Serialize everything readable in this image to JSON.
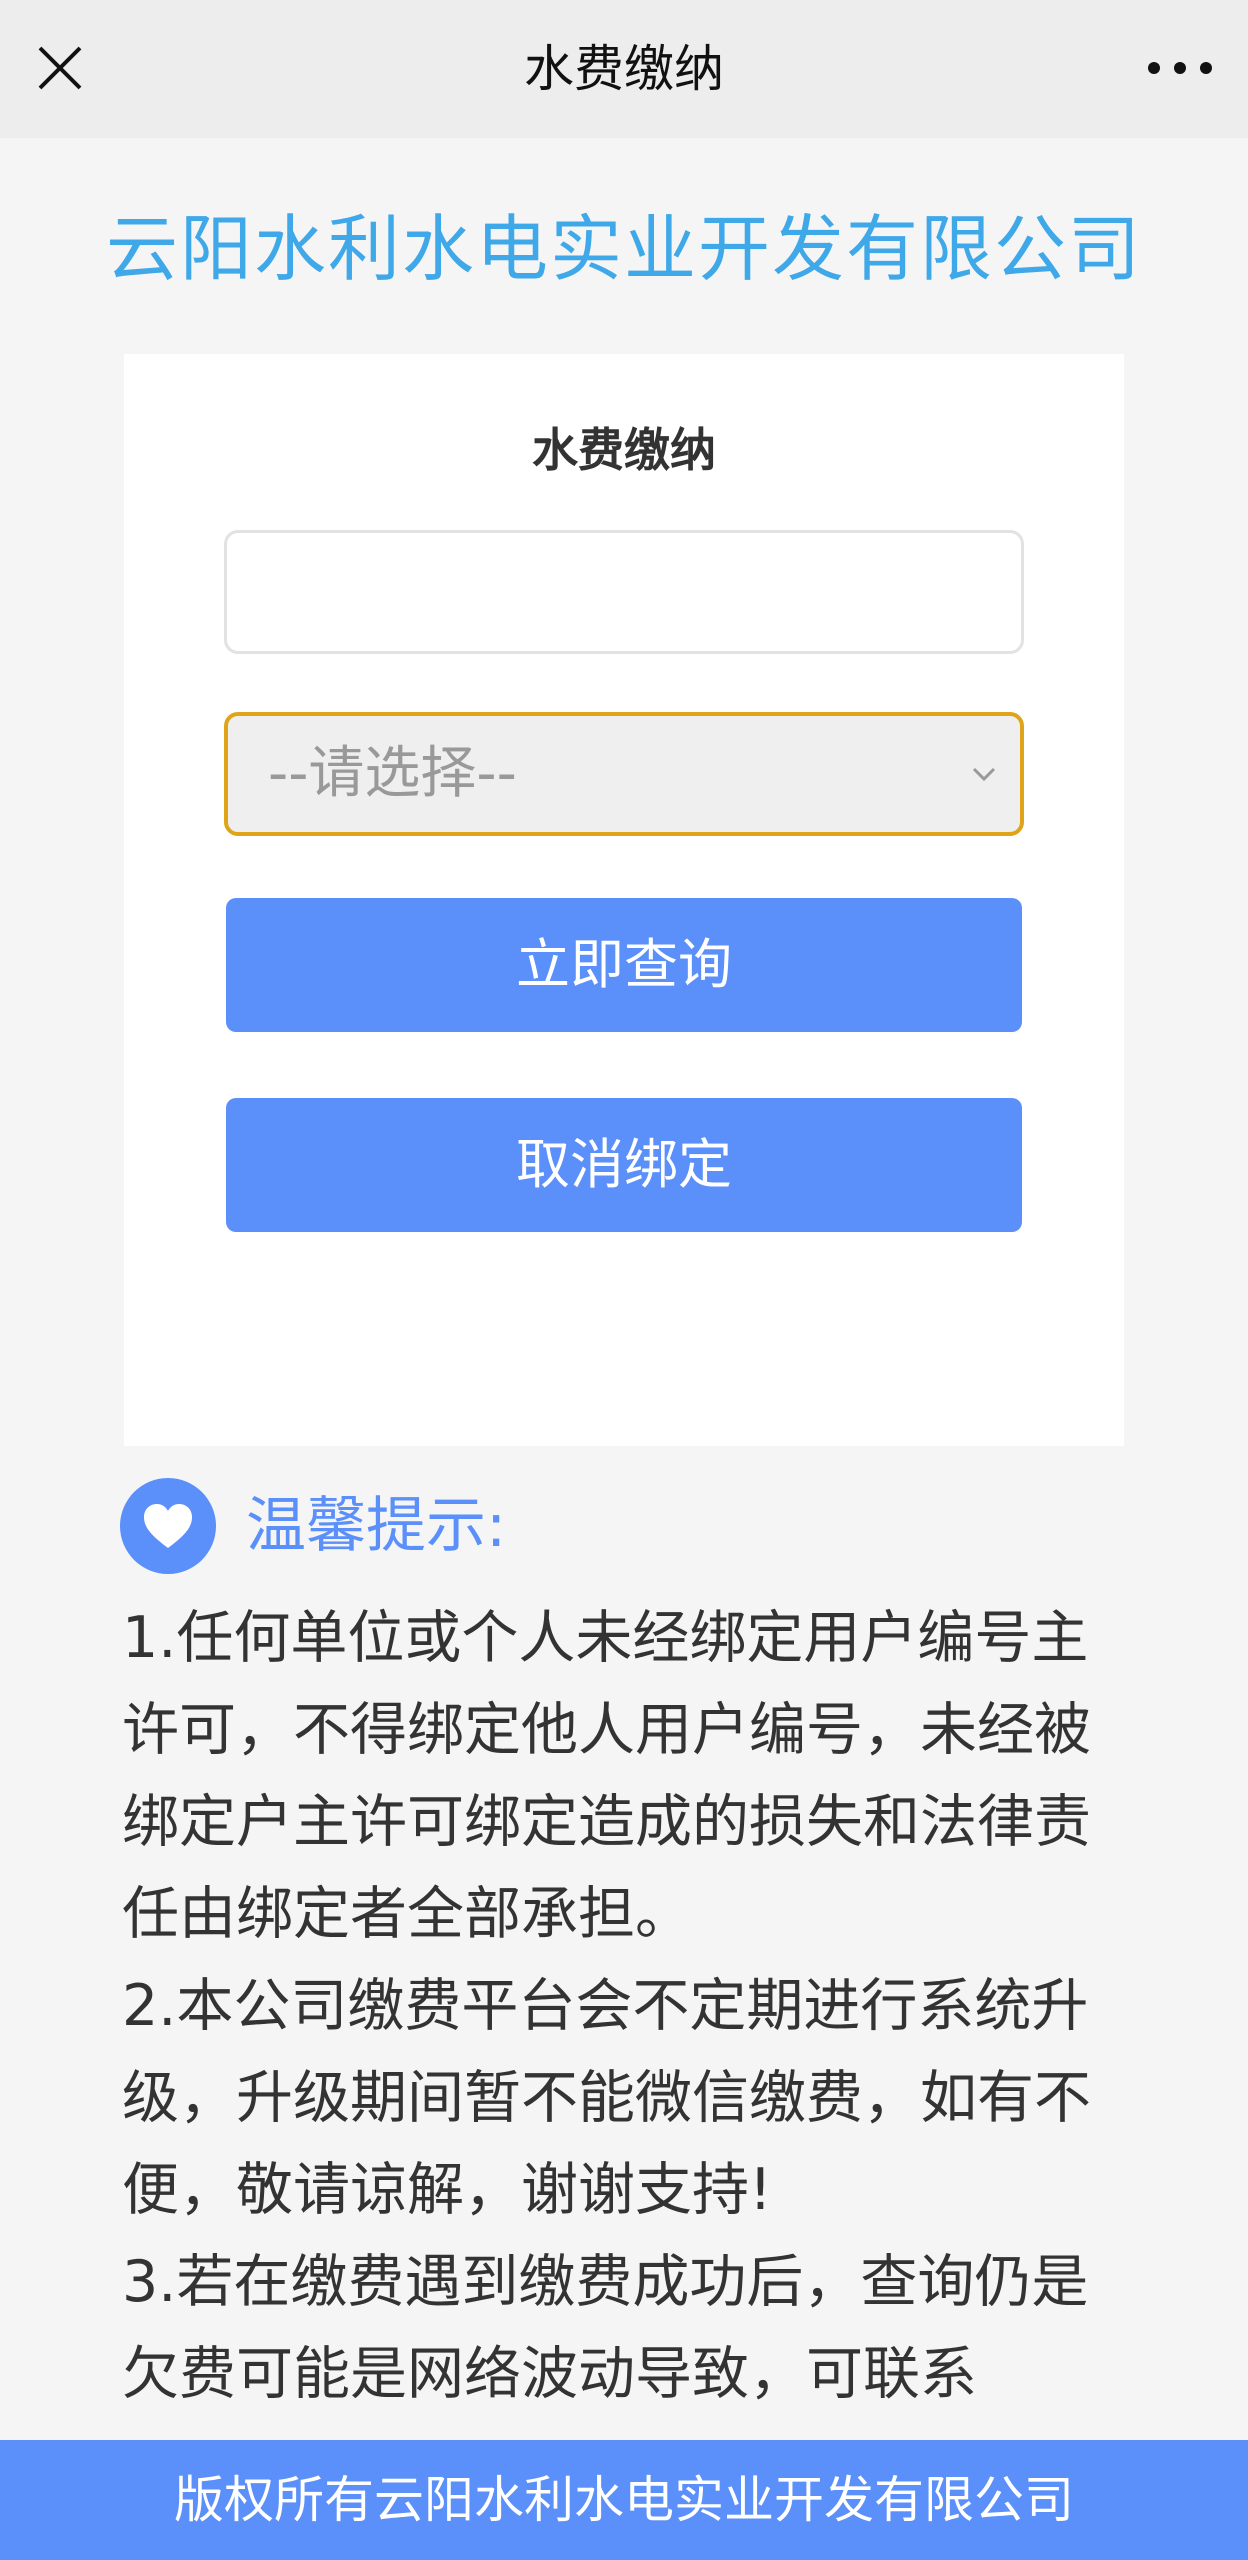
{
  "topbar": {
    "title": "水费缴纳",
    "close_icon": "close-icon",
    "more_icon": "more-dots-icon"
  },
  "company_title": "云阳水利水电实业开发有限公司",
  "form": {
    "title": "水费缴纳",
    "account_input": {
      "value": "",
      "placeholder": ""
    },
    "select": {
      "selected": "--请选择--"
    },
    "query_button": "立即查询",
    "unbind_button": "取消绑定"
  },
  "tips": {
    "title": "温馨提示:",
    "items": [
      "1.任何单位或个人未经绑定用户编号主许可，不得绑定他人用户编号，未经被绑定户主许可绑定造成的损失和法律责任由绑定者全部承担。",
      "2.本公司缴费平台会不定期进行系统升级，升级期间暂不能微信缴费，如有不便，敬请谅解，谢谢支持!",
      "3.若在缴费遇到缴费成功后，查询仍是欠费可能是网络波动导致，可联系"
    ]
  },
  "footer": "版权所有云阳水利水电实业开发有限公司",
  "colors": {
    "accent": "#5b8ff9",
    "company_title": "#3fa8e8",
    "select_border": "#e0a41a"
  }
}
